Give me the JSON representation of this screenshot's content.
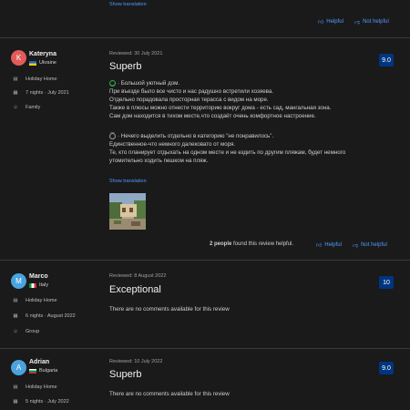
{
  "top": {
    "show_translation": "Show translation",
    "helpful": "Helpful",
    "not_helpful": "Not helpful"
  },
  "reviews": [
    {
      "initial": "K",
      "avatar_color": "#e25b5b",
      "name": "Kateryna",
      "country": "Ukraine",
      "room": "Holiday Home",
      "stay": "7 nights · July 2021",
      "traveler": "Family",
      "reviewed": "Reviewed: 30 July 2021",
      "title": "Superb",
      "score": "9.0",
      "positive": [
        "· Большой уютный дом.",
        "При въезде было все чисто и нас радушно встретили хозяева.",
        "Отдельно порадовала просторная терасса с видом на море.",
        "Также в плюсы можно отнести территорию вокруг дома - есть сад, мангальная зона.",
        "Сам дом находится в тихом месте,что создаёт очень комфортное настроение."
      ],
      "negative": [
        "· Нечего выделить отдельно в категорию \"не понравилось\".",
        "Единственное-что немного далековато от моря.",
        "Те, кто планирует отдыхать на одном месте и не ездить по другим пляжам, будет немного",
        "утомительно ходить пешком на пляж."
      ],
      "show_translation": "Show translation",
      "found_helpful_count": "2 people",
      "found_helpful_text": " found this review helpful.",
      "helpful": "Helpful",
      "not_helpful": "Not helpful"
    },
    {
      "initial": "M",
      "avatar_color": "#4aa3df",
      "name": "Marco",
      "country": "Italy",
      "room": "Holiday Home",
      "stay": "6 nights · August 2022",
      "traveler": "Group",
      "reviewed": "Reviewed: 8 August 2022",
      "title": "Exceptional",
      "score": "10",
      "no_comments": "There are no comments available for this review"
    },
    {
      "initial": "A",
      "avatar_color": "#4aa3df",
      "name": "Adrian",
      "country": "Bulgaria",
      "room": "Holiday Home",
      "stay": "5 nights · July 2022",
      "reviewed": "Reviewed: 10 July 2022",
      "title": "Superb",
      "score": "9.0",
      "no_comments": "There are no comments available for this review"
    }
  ],
  "colors": {
    "accent": "#4f9bff",
    "score_bg": "#003580",
    "positive": "#2eae4f"
  }
}
